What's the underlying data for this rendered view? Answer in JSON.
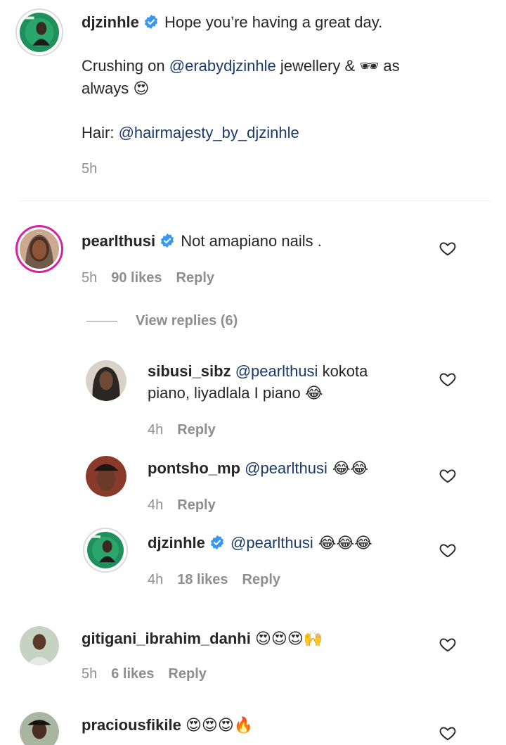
{
  "caption": {
    "username": "djzinhle",
    "line1": "Hope you’re having a great day.",
    "line2_prefix": "Crushing on ",
    "line2_mention": "@erabydjzinhle",
    "line2_suffix": " jewellery & ",
    "line2_emoji": "🕶",
    "line2_end": " as",
    "line3": "always ",
    "line3_emoji": "😍",
    "hair_prefix": "Hair: ",
    "hair_mention": "@hairmajesty_by_djzinhle",
    "time": "5h"
  },
  "comments": [
    {
      "username": "pearlthusi",
      "text": "Not amapiano nails .",
      "time": "5h",
      "likes": "90 likes",
      "reply": "Reply",
      "view_replies": "View replies (6)"
    },
    {
      "username": "sibusi_sibz",
      "mention": "@pearlthusi",
      "text": " kokota",
      "text2": "piano, liyadlala I piano ",
      "emoji": "😂",
      "time": "4h",
      "reply": "Reply"
    },
    {
      "username": "pontsho_mp",
      "mention": "@pearlthusi",
      "emoji": " 😂😂",
      "time": "4h",
      "reply": "Reply"
    },
    {
      "username": "djzinhle",
      "mention": "@pearlthusi",
      "emoji": " 😂😂😂",
      "time": "4h",
      "likes": "18 likes",
      "reply": "Reply"
    },
    {
      "username": "gitigani_ibrahim_danhi",
      "emoji": "😍😍😍🙌",
      "time": "5h",
      "likes": "6 likes",
      "reply": "Reply"
    },
    {
      "username": "praciousfikile",
      "emoji": "😍😍😍🔥"
    }
  ],
  "colors": {
    "verified": "#3897f0",
    "mention": "#1b3a6b",
    "meta": "#8e8e8e"
  },
  "icons": {
    "like": "heart-outline-icon",
    "verified": "verified-badge-icon"
  }
}
